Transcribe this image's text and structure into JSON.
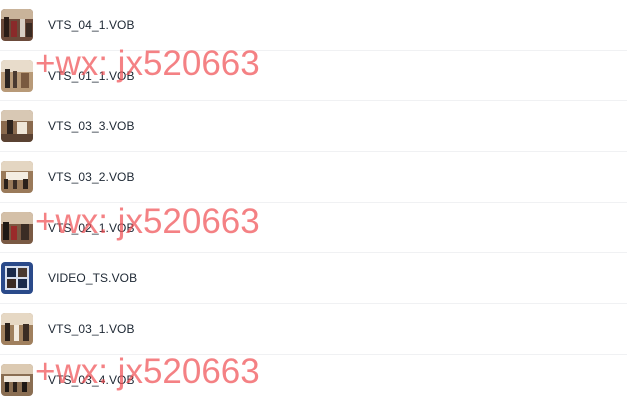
{
  "files": [
    {
      "name": "VTS_04_1.VOB",
      "thumb": "event-photo"
    },
    {
      "name": "VTS_01_1.VOB",
      "thumb": "event-photo"
    },
    {
      "name": "VTS_03_3.VOB",
      "thumb": "event-photo"
    },
    {
      "name": "VTS_03_2.VOB",
      "thumb": "event-photo"
    },
    {
      "name": "VTS_02_1.VOB",
      "thumb": "event-photo"
    },
    {
      "name": "VIDEO_TS.VOB",
      "thumb": "dvd-menu"
    },
    {
      "name": "VTS_03_1.VOB",
      "thumb": "event-photo"
    },
    {
      "name": "VTS_03_4.VOB",
      "thumb": "event-photo"
    }
  ],
  "watermarks": [
    "+wx: jx520663",
    "+wx: jx520663",
    "+wx: jx520663"
  ],
  "colors": {
    "text": "#1d2733",
    "divider": "#f0f1f3",
    "watermark": "#f05055",
    "dvd_menu_bg": "#2a4a8a"
  }
}
